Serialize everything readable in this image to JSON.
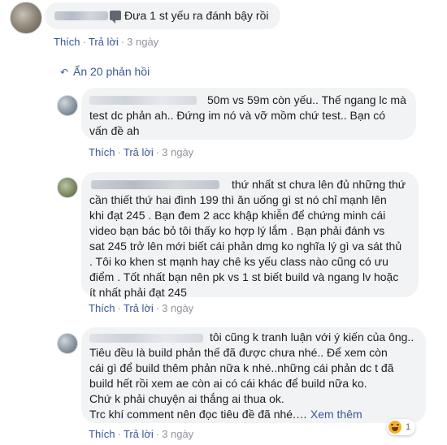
{
  "comment": {
    "text": "Đưa 1 st yếu ra đánh bậy rồi",
    "actions": {
      "like": "Thích",
      "reply": "Trả lời",
      "time": "3 ngày"
    }
  },
  "hide_replies": "Ẩn 20 phản hồi",
  "replies": [
    {
      "lines": [
        "50m vs 59m còn yếu.. Thế ngang lc mà",
        "test dc phản ah.. Đứng im nó và vỡ mồm chứ test.. Bạn có",
        "vấn đề ah"
      ],
      "actions": {
        "like": "Thích",
        "reply": "Trả lời",
        "time": "3 ngày"
      }
    },
    {
      "lines": [
        "thứ nhất st chưa lên đủ những thứ",
        "cần thiết thứ hai đình 199 thì ăn uống gì st nó chỉ mạnh lên",
        "khi đạt 245 . Bạn đem 2 acc khập khiễn để chứng minh cái",
        "video bạn bác bỏ tôi thấy ko hợp lý lắm . Bạn phải đánh vs",
        "sat 245 trở lên mới biết cái phản dmg ko nghĩa lý gì va sát thủ",
        ". Tôi ko khen st mạnh hay chê ks yếu class nào cũng có ưu",
        "điểm . Tốt nhất bạn nên pk vs 1 st biết build và ngang lv hoặc",
        "ít nhất phải đạt 245"
      ],
      "actions": {
        "like": "Thích",
        "reply": "Trả lời",
        "time": "3 ngày"
      }
    },
    {
      "lines": [
        "tôi cũng k tranh luận với ý kiến của ông..",
        "Tiêu đều là build phản thế đã được chưa nhé.. Để xem còn",
        "cái gì để build thêm phản nữa k nhé..những cái phản dc t đã",
        "build hết rồi xem ae còn ai có cái khác để build nữa ko.",
        "Chứ k phải chuyện ai thắng ai thua ok.",
        "Trc khí comment nên đọc tiêu đề đã nhé.…"
      ],
      "see_more": "Xem thêm",
      "reaction_count": "1",
      "actions": {
        "like": "Thích",
        "reply": "Trả lời",
        "time": "3 ngày"
      }
    }
  ],
  "colors": {
    "link": "#385898",
    "bubble": "#f2f3f5",
    "meta": "#90949c"
  }
}
